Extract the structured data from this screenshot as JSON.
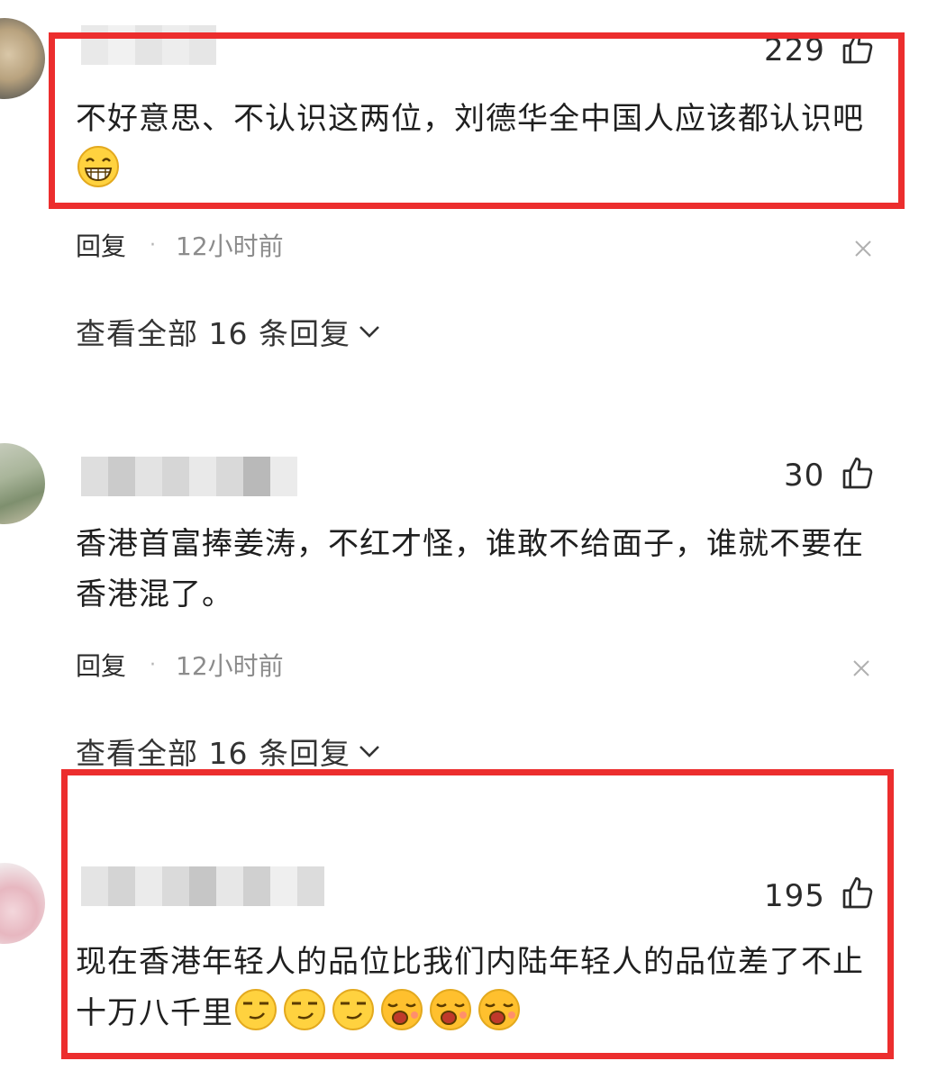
{
  "comments": [
    {
      "likes": "229",
      "text": "不好意思、不认识这两位，刘德华全中国人应该都认识吧",
      "emojis": [
        "grin-icon"
      ],
      "reply_label": "回复",
      "time": "12小时前",
      "view_all": "查看全部 16 条回复"
    },
    {
      "likes": "30",
      "text": "香港首富捧姜涛，不红才怪，谁敢不给面子，谁就不要在香港混了。",
      "emojis": [],
      "reply_label": "回复",
      "time": "12小时前",
      "view_all": "查看全部 16 条回复"
    },
    {
      "likes": "195",
      "text": "现在香港年轻人的品位比我们内陆年轻人的品位差了不止十万八千里",
      "emojis": [
        "smirk-icon",
        "smirk-icon",
        "smirk-icon",
        "yawn-icon",
        "yawn-icon",
        "yawn-icon"
      ]
    }
  ],
  "separator": "·",
  "colors": {
    "highlight": "#ec2e2e",
    "muted": "#8c8c8c"
  }
}
